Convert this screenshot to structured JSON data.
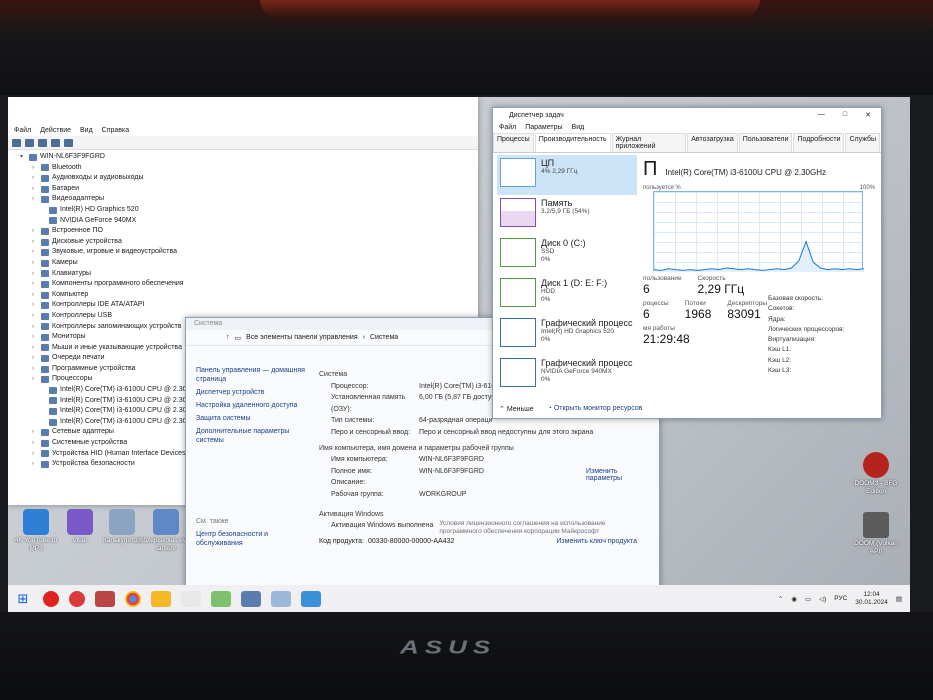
{
  "device_manager": {
    "menu": [
      "Файл",
      "Действие",
      "Вид",
      "Справка"
    ],
    "root": "WIN-NL6F3F9FGRD",
    "items": [
      {
        "label": "Bluetooth",
        "level": 1
      },
      {
        "label": "Аудиовходы и аудиовыходы",
        "level": 1
      },
      {
        "label": "Батареи",
        "level": 1
      },
      {
        "label": "Видеоадаптеры",
        "level": 1
      },
      {
        "label": "Intel(R) HD Graphics 520",
        "level": 2
      },
      {
        "label": "NVIDIA GeForce 940MX",
        "level": 2
      },
      {
        "label": "Встроенное ПО",
        "level": 1
      },
      {
        "label": "Дисковые устройства",
        "level": 1
      },
      {
        "label": "Звуковые, игровые и видеоустройства",
        "level": 1
      },
      {
        "label": "Камеры",
        "level": 1
      },
      {
        "label": "Клавиатуры",
        "level": 1
      },
      {
        "label": "Компоненты программного обеспечения",
        "level": 1
      },
      {
        "label": "Компьютер",
        "level": 1
      },
      {
        "label": "Контроллеры IDE ATA/ATAPI",
        "level": 1
      },
      {
        "label": "Контроллеры USB",
        "level": 1
      },
      {
        "label": "Контроллеры запоминающих устройств",
        "level": 1
      },
      {
        "label": "Мониторы",
        "level": 1
      },
      {
        "label": "Мыши и иные указывающие устройства",
        "level": 1
      },
      {
        "label": "Очереди печати",
        "level": 1
      },
      {
        "label": "Программные устройства",
        "level": 1
      },
      {
        "label": "Процессоры",
        "level": 1
      },
      {
        "label": "Intel(R) Core(TM) i3-6100U CPU @ 2.30GHz",
        "level": 2
      },
      {
        "label": "Intel(R) Core(TM) i3-6100U CPU @ 2.30GHz",
        "level": 2
      },
      {
        "label": "Intel(R) Core(TM) i3-6100U CPU @ 2.30GHz",
        "level": 2
      },
      {
        "label": "Intel(R) Core(TM) i3-6100U CPU @ 2.30GHz",
        "level": 2
      },
      {
        "label": "Сетевые адаптеры",
        "level": 1
      },
      {
        "label": "Системные устройства",
        "level": 1
      },
      {
        "label": "Устройства HID (Human Interface Devices)",
        "level": 1
      },
      {
        "label": "Устройства безопасности",
        "level": 1
      }
    ]
  },
  "system_panel": {
    "title": "Система",
    "breadcrumb": [
      "Все элементы панели управления",
      "Система"
    ],
    "left_links": [
      "Панель управления — домашняя страница",
      "Диспетчер устройств",
      "Настройка удаленного доступа",
      "Защита системы",
      "Дополнительные параметры системы"
    ],
    "see_also_label": "См. также",
    "see_also": [
      "Центр безопасности и обслуживания"
    ],
    "system_section": "Система",
    "system_rows": [
      {
        "k": "Процессор:",
        "v": "Intel(R) Core(TM) i3-6100"
      },
      {
        "k": "Установленная память (ОЗУ):",
        "v": "6,00 ГБ (5,87 ГБ доступно)"
      },
      {
        "k": "Тип системы:",
        "v": "64-разрядная операци"
      },
      {
        "k": "Перо и сенсорный ввод:",
        "v": "Перо и сенсорный ввод недоступны для этого экрана"
      }
    ],
    "name_section": "Имя компьютера, имя домена и параметры рабочей группы",
    "name_rows": [
      {
        "k": "Имя компьютера:",
        "v": "WIN-NL6F3F9FGRD"
      },
      {
        "k": "Полное имя:",
        "v": "WIN-NL6F3F9FGRD"
      },
      {
        "k": "Описание:",
        "v": ""
      },
      {
        "k": "Рабочая группа:",
        "v": "WORKGROUP"
      }
    ],
    "change_params": "Изменить параметры",
    "activation_section": "Активация Windows",
    "activation_status": "Активация Windows выполнена",
    "activation_terms": "Условия лицензионного соглашения на использование программного обеспечения корпорации Майкрософт",
    "product_code_label": "Код продукта:",
    "product_code": "00330-80000-00000-AA432",
    "change_key": "Изменить ключ продукта"
  },
  "task_manager": {
    "title": "Диспетчер задач",
    "menu": [
      "Файл",
      "Параметры",
      "Вид"
    ],
    "tabs": [
      "Процессы",
      "Производительность",
      "Журнал приложений",
      "Автозагрузка",
      "Пользователи",
      "Подробности",
      "Службы"
    ],
    "resources": [
      {
        "name": "ЦП",
        "sub1": "4% 2,29 ГГц",
        "sub2": ""
      },
      {
        "name": "Память",
        "sub1": "3,2/5,9 ГБ (54%)",
        "sub2": ""
      },
      {
        "name": "Диск 0 (C:)",
        "sub1": "SSD",
        "sub2": "0%"
      },
      {
        "name": "Диск 1 (D: E: F:)",
        "sub1": "HDD",
        "sub2": "0%"
      },
      {
        "name": "Графический процесс",
        "sub1": "Intel(R) HD Graphics 520",
        "sub2": "0%"
      },
      {
        "name": "Графический процесс",
        "sub1": "NVIDIA GeForce 940MX",
        "sub2": "0%"
      }
    ],
    "detail_big": "П",
    "detail_model": "Intel(R) Core(TM) i3-6100U CPU @ 2.30GHz",
    "util_label": "пользуется %",
    "util_max": "100%",
    "stats": [
      {
        "label": "пользование",
        "value": "6"
      },
      {
        "label": "Скорость",
        "value": "2,29 ГГц"
      }
    ],
    "stats2": [
      {
        "label": "роцессы",
        "value": "6"
      },
      {
        "label": "Потоки",
        "value": "1968"
      },
      {
        "label": "Дескрипторы",
        "value": "83091"
      }
    ],
    "uptime_label": "мя работы",
    "uptime": "21:29:48",
    "side": [
      "Базовая скорость:",
      "Сокетов:",
      "Ядра:",
      "Логических процессоров:",
      "Виртуализация:",
      "Кэш L1:",
      "Кэш L2:",
      "Кэш L3:"
    ],
    "less": "Меньше",
    "open_monitor": "Открыть монитор ресурсов",
    "cpu_history": [
      3,
      2,
      4,
      3,
      2,
      3,
      2,
      3,
      4,
      3,
      5,
      4,
      3,
      4,
      3,
      2,
      3,
      4,
      3,
      5,
      14,
      38,
      12,
      5,
      3,
      4,
      3,
      4,
      3,
      4
    ]
  },
  "desktop_icons": [
    {
      "label": "4K YouTube to MP3",
      "color": "#2f7fd6"
    },
    {
      "label": "Viber",
      "color": "#7b58c7"
    },
    {
      "label": "Калькулятор",
      "color": "#8aa4c2"
    },
    {
      "label": "Középiskolás éves tanterv",
      "color": "#5e88c6"
    }
  ],
  "right_icons": [
    {
      "label": "DOOM3 - BFG Edition",
      "color": "#b4231c"
    },
    {
      "label": "DOOM (Vulkan API)",
      "color": "#5c5c5c"
    }
  ],
  "taskbar": {
    "lang": "РУС",
    "time": "12:04",
    "date": "30.01.2024"
  }
}
